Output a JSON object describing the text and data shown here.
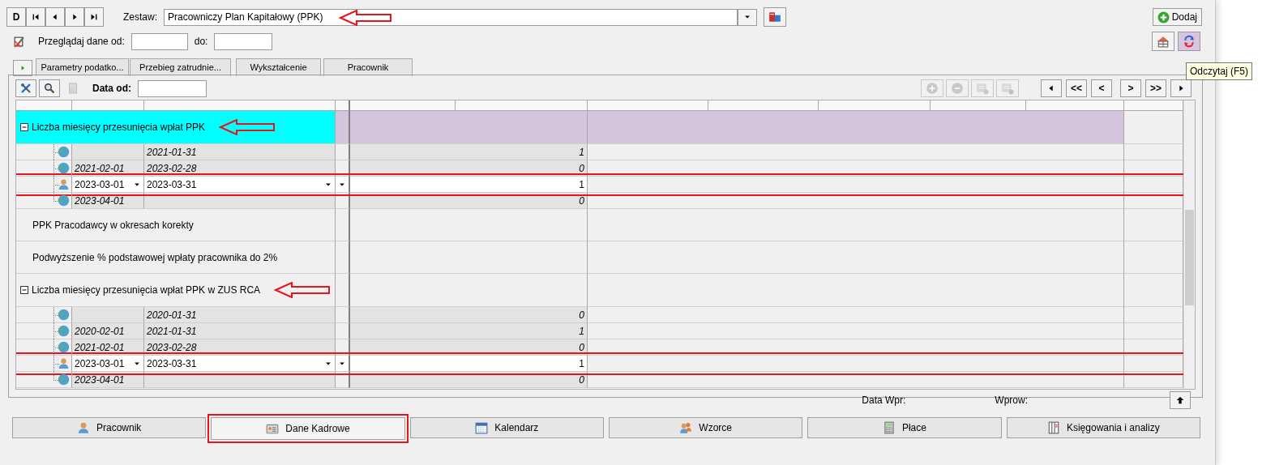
{
  "toolbar": {
    "nav_buttons": [
      {
        "kind": "text",
        "label": "D"
      },
      {
        "kind": "first"
      },
      {
        "kind": "prev"
      },
      {
        "kind": "next"
      },
      {
        "kind": "last"
      }
    ],
    "set_label": "Zestaw:",
    "set_value": "Pracowniczy Plan Kapitałowy (PPK)",
    "set_annotated": true,
    "add_button": "Dodaj"
  },
  "browse": {
    "label": "Przeglądaj dane od:",
    "to_label": "do:"
  },
  "tabs": [
    {
      "label": "Parametry podatko...",
      "selected": false
    },
    {
      "label": "Przebieg zatrudnie...",
      "selected": false
    },
    {
      "label": "Wykształcenie",
      "selected": false
    },
    {
      "label": "Pracownik",
      "selected": false
    }
  ],
  "tooltip": "Odczytaj (F5)",
  "panel": {
    "tool_buttons": [
      {
        "kind": "tools",
        "disabled": false
      },
      {
        "kind": "search",
        "disabled": false
      },
      {
        "kind": "calculator",
        "disabled": true
      }
    ],
    "date_label": "Data od:",
    "record_buttons": [
      {
        "kind": "plus",
        "disabled": true
      },
      {
        "kind": "minus",
        "disabled": true
      },
      {
        "kind": "record-add",
        "disabled": true
      },
      {
        "kind": "record-remove",
        "disabled": true
      }
    ],
    "nav_buttons": [
      {
        "kind": "prev"
      },
      {
        "kind": "text",
        "label": "<<"
      },
      {
        "kind": "text",
        "label": "<"
      },
      {
        "kind": "text",
        "label": ">"
      },
      {
        "kind": "text",
        "label": ">>"
      },
      {
        "kind": "next"
      }
    ]
  },
  "grid": {
    "rows": [
      {
        "kind": "group",
        "label": "Liczba miesięcy przesunięcia wpłat PPK",
        "expanded": true,
        "highlighted": true,
        "annotated": true,
        "children": [
          {
            "kind": "globe",
            "to": "2021-01-31",
            "value": "1",
            "editing": false
          },
          {
            "kind": "globe",
            "from": "2021-02-01",
            "to": "2023-02-28",
            "value": "0",
            "editing": false
          },
          {
            "kind": "person",
            "from": "2023-03-01",
            "to": "2023-03-31",
            "value": "1",
            "editing": true
          },
          {
            "kind": "globe",
            "from": "2023-04-01",
            "value": "0",
            "editing": false
          }
        ]
      },
      {
        "kind": "text",
        "label": "PPK Pracodawcy w okresach korekty"
      },
      {
        "kind": "text",
        "label": "Podwyższenie % podstawowej wpłaty pracownika do 2%"
      },
      {
        "kind": "group",
        "label": "Liczba miesięcy przesunięcia wpłat PPK w ZUS RCA",
        "expanded": true,
        "highlighted": false,
        "annotated": true,
        "children": [
          {
            "kind": "globe",
            "to": "2020-01-31",
            "value": "0",
            "editing": false
          },
          {
            "kind": "globe",
            "from": "2020-02-01",
            "to": "2021-01-31",
            "value": "1",
            "editing": false
          },
          {
            "kind": "globe",
            "from": "2021-02-01",
            "to": "2023-02-28",
            "value": "0",
            "editing": false
          },
          {
            "kind": "person",
            "from": "2023-03-01",
            "to": "2023-03-31",
            "value": "1",
            "editing": true
          },
          {
            "kind": "globe",
            "from": "2023-04-01",
            "value": "0",
            "editing": false
          }
        ]
      }
    ]
  },
  "footer": {
    "date_label": "Data Wpr:",
    "entered_label": "Wprow:"
  },
  "bottom_tabs": [
    {
      "label": "Pracownik",
      "kind": "person",
      "selected": false,
      "annotated": false
    },
    {
      "label": "Dane Kadrowe",
      "kind": "card",
      "selected": true,
      "annotated": true
    },
    {
      "label": "Kalendarz",
      "kind": "calendar",
      "selected": false,
      "annotated": false
    },
    {
      "label": "Wzorce",
      "kind": "people",
      "selected": false,
      "annotated": false
    },
    {
      "label": "Płace",
      "kind": "calculator",
      "selected": false,
      "annotated": false
    },
    {
      "label": "Księgowania i analizy",
      "kind": "ledger",
      "selected": false,
      "annotated": false
    }
  ]
}
